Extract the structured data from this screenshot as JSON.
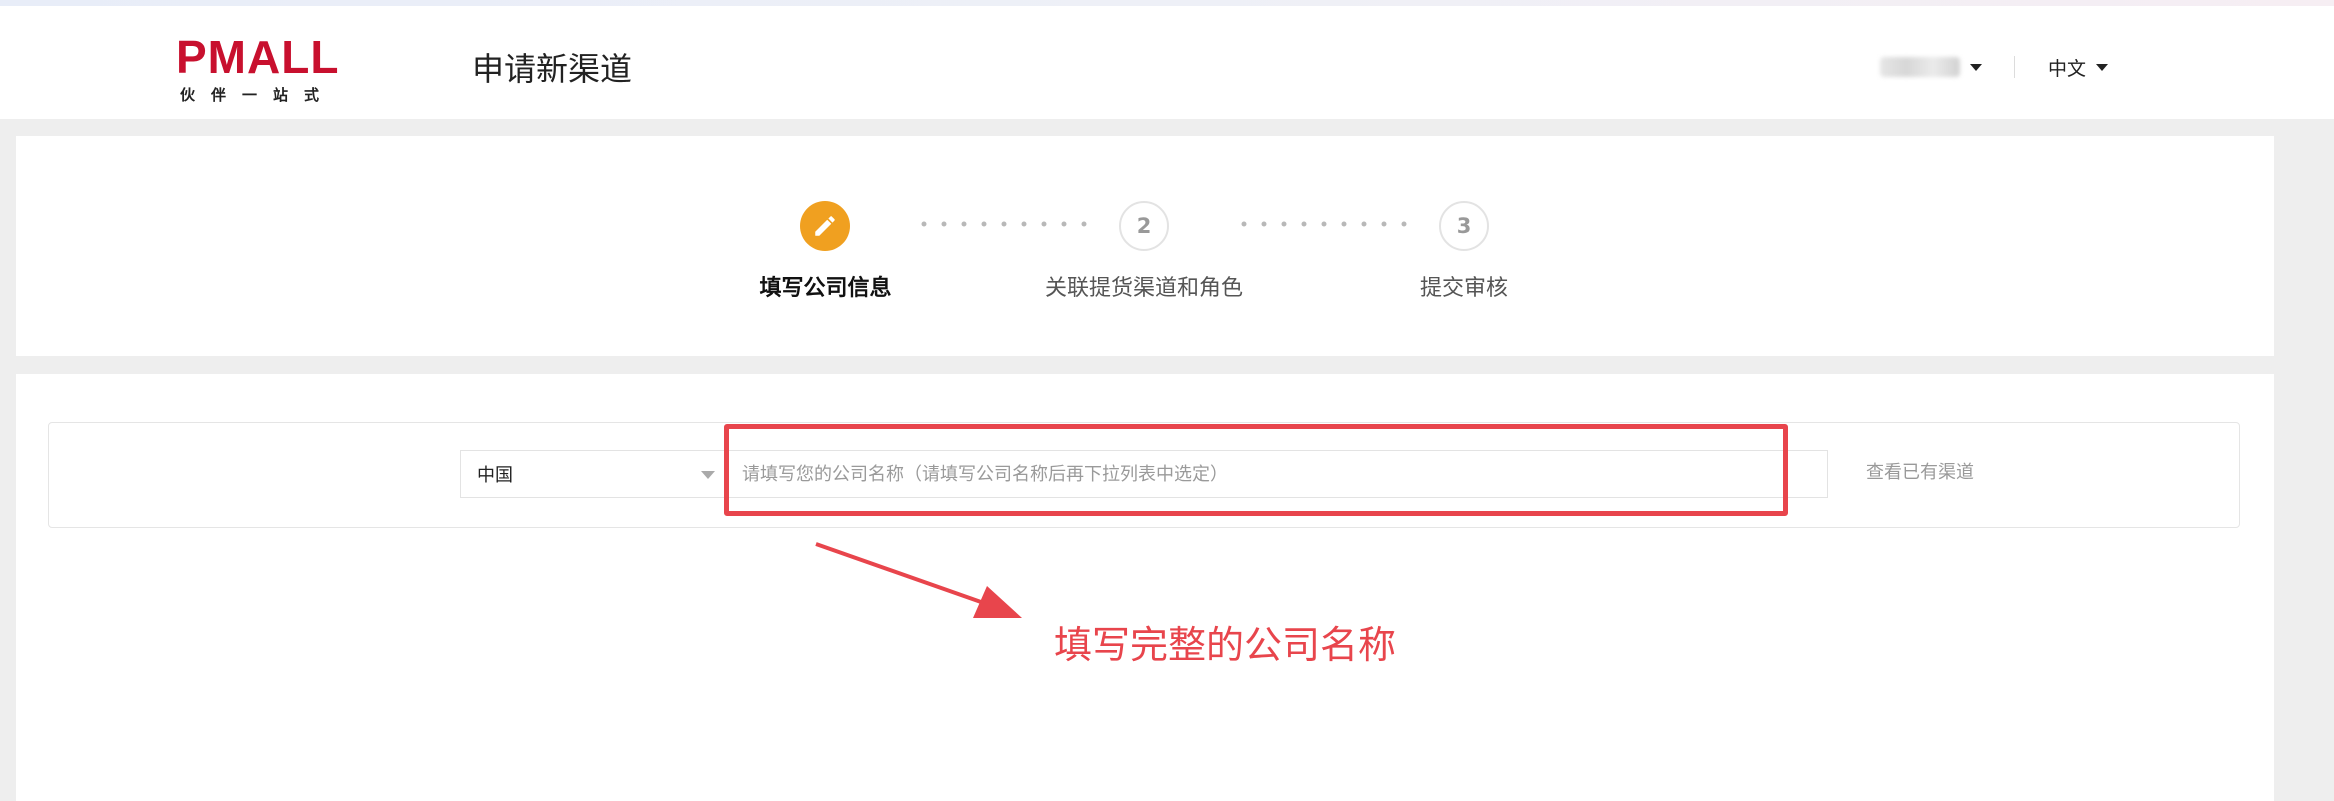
{
  "header": {
    "logo_text": "PMALL",
    "logo_subtitle": "伙伴一站式",
    "page_title": "申请新渠道",
    "language": "中文"
  },
  "steps": [
    {
      "number": "1",
      "label": "填写公司信息",
      "state": "active",
      "icon": "pencil-icon"
    },
    {
      "number": "2",
      "label": "关联提货渠道和角色",
      "state": "pending"
    },
    {
      "number": "3",
      "label": "提交审核",
      "state": "pending"
    }
  ],
  "form": {
    "country_value": "中国",
    "company_placeholder": "请填写您的公司名称（请填写公司名称后再下拉列表中选定）",
    "view_link": "查看已有渠道"
  },
  "annotation": {
    "text": "填写完整的公司名称",
    "color": "#e8454c"
  },
  "colors": {
    "brand": "#c8102e",
    "active_step": "#f0a020",
    "highlight": "#e8454c"
  }
}
